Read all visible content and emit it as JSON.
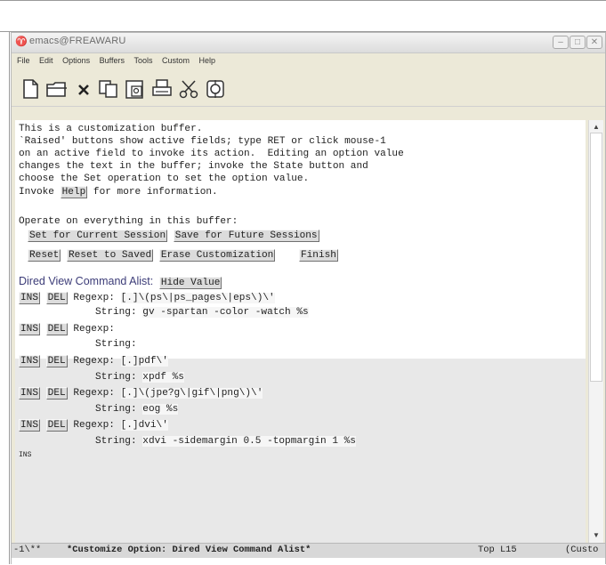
{
  "window": {
    "title": "emacs@FREAWARU",
    "minimize": "–",
    "maximize": "□",
    "close": "✕"
  },
  "menu": [
    "File",
    "Edit",
    "Options",
    "Buffers",
    "Tools",
    "Custom",
    "Help"
  ],
  "toolbar": {
    "icons": [
      "new-file-icon",
      "open-folder-icon",
      "close-x-icon",
      "copy-icon",
      "paste-icon",
      "print-icon",
      "cut-scissors-icon",
      "preferences-icon"
    ]
  },
  "buffer": {
    "intro": [
      "This is a customization buffer.",
      "`Raised' buttons show active fields; type RET or click mouse-1",
      "on an active field to invoke its action.  Editing an option value",
      "changes the text in the buffer; invoke the State button and",
      "choose the Set operation to set the option value."
    ],
    "invoke_prefix": "Invoke ",
    "help_button": "Help",
    "invoke_suffix": " for more information.",
    "operate": "Operate on everything in this buffer:",
    "btn_set_current": "Set for Current Session",
    "btn_save_future": "Save for Future Sessions",
    "btn_reset": "Reset",
    "btn_reset_saved": "Reset to Saved",
    "btn_erase": "Erase Customization",
    "btn_finish": "Finish",
    "option_name": "Dired View Command Alist:",
    "hide_value": "Hide Value",
    "ins": "INS",
    "del": "DEL",
    "regexp_label": "Regexp:",
    "string_label": "String:",
    "entries": [
      {
        "regexp": "[.]\\(ps\\|ps_pages\\|eps\\)\\'",
        "string": "gv -spartan -color -watch %s"
      },
      {
        "regexp": "",
        "string": ""
      },
      {
        "regexp": "[.]pdf\\'",
        "string": "xpdf %s"
      },
      {
        "regexp": "[.]\\(jpe?g\\|gif\\|png\\)\\'",
        "string": "eog %s"
      },
      {
        "regexp": "[.]dvi\\'",
        "string": "xdvi -sidemargin 0.5 -topmargin 1 %s"
      }
    ],
    "trailing_ins": "INS"
  },
  "modeline": {
    "status": "-1\\**",
    "buffer_name": "*Customize Option: Dired View Command Alist*",
    "position": "Top L15",
    "mode": "(Custo"
  },
  "scrollbar": {
    "up": "▲",
    "down": "▼"
  }
}
